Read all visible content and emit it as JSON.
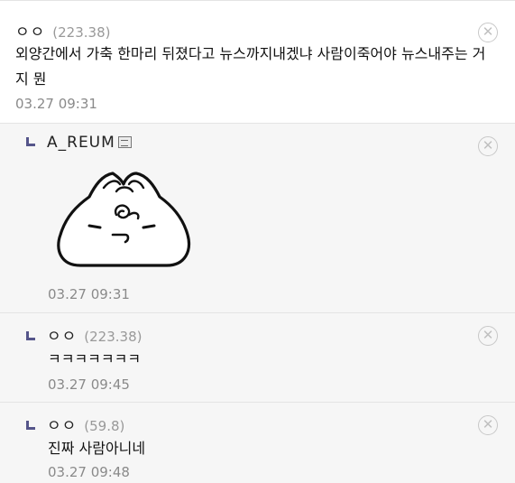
{
  "comments": [
    {
      "nick": "ㅇㅇ",
      "ip": "(223.38)",
      "text": "외양간에서 가축 한마리 뒤졌다고 뉴스까지내겠냐 사람이죽어야 뉴스내주는 거지 뭔",
      "date": "03.27 09:31"
    }
  ],
  "replies": [
    {
      "nick": "A_REUM",
      "date": "03.27 09:31",
      "sticker": "dumpling-emoticon"
    },
    {
      "nick": "ㅇㅇ",
      "ip": "(223.38)",
      "text": "ㅋㅋㅋㅋㅋㅋㅋ",
      "date": "03.27 09:45"
    },
    {
      "nick": "ㅇㅇ",
      "ip": "(59.8)",
      "text": "진짜 사람아니네",
      "date": "03.27 09:48"
    }
  ],
  "delete_glyph": "⊗",
  "icons": {
    "reply": "reply-arrow-icon",
    "user": "fixed-nick-icon",
    "delete": "delete-icon"
  },
  "colors": {
    "reply_mark": "#55558a",
    "reply_bg": "#f6f6f6",
    "meta_text": "#8a8a8a"
  }
}
